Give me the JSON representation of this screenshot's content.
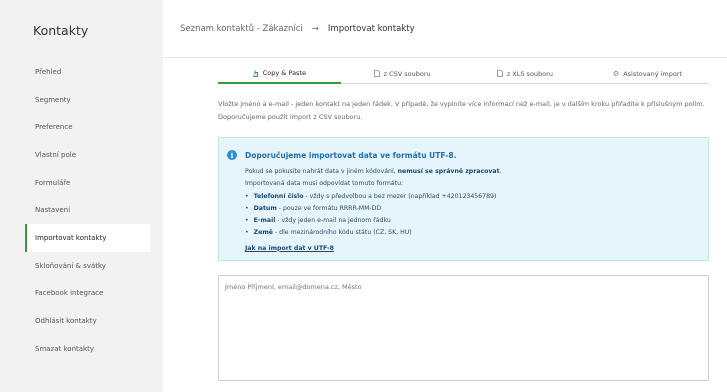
{
  "sidebar": {
    "title": "Kontakty",
    "items": [
      {
        "label": "Přehled"
      },
      {
        "label": "Segmenty"
      },
      {
        "label": "Preference"
      },
      {
        "label": "Vlastní pole"
      },
      {
        "label": "Formuláře"
      },
      {
        "label": "Nastavení"
      },
      {
        "label": "Importovat kontakty"
      },
      {
        "label": "Skloňování & svátky"
      },
      {
        "label": "Facebook integrace"
      },
      {
        "label": "Odhlásit kontakty"
      },
      {
        "label": "Smazat kontakty"
      }
    ],
    "active_index": 6
  },
  "breadcrumb": {
    "parent": "Seznam kontaktů - Zákazníci",
    "separator": "→",
    "current": "Importovat kontakty"
  },
  "tabs": [
    {
      "label": "Copy & Paste",
      "icon": "hand-pointer-icon"
    },
    {
      "label": "z CSV souboru",
      "icon": "file-icon"
    },
    {
      "label": "z XLS souboru",
      "icon": "file-icon"
    },
    {
      "label": "Asistovaný import",
      "icon": "gear-icon"
    }
  ],
  "intro": {
    "line1": "Vložte jméno a e-mail - jeden kontakt na jeden řádek. V případě, že vyplníte více informací než e-mail, je v dalším kroku přiřadíte k příslušným polím.",
    "line2": "Doporučujeme použít import z CSV souboru."
  },
  "info": {
    "title": "Doporučujeme importovat data ve formátu UTF-8.",
    "line1_pre": "Pokud se pokusíte nahrát data v jiném kódování, ",
    "line1_bold": "nemusí se správně zpracovat",
    "line1_post": ".",
    "line2": "Importovaná data musí odpovídat tomuto formátu:",
    "bullets": [
      {
        "bold": "Telefonní číslo",
        "text": " - vždy s předvolbou a bez mezer (například +420123456789)"
      },
      {
        "bold": "Datum",
        "text": " - pouze ve formátu RRRR-MM-DD"
      },
      {
        "bold": "E-mail",
        "text": " - vždy jeden e-mail na jednom řádku"
      },
      {
        "bold": "Země",
        "text": " - dle mezinárodního kódu státu (CZ, SK, HU)"
      }
    ],
    "link": "Jak na import dat v UTF-8"
  },
  "textarea": {
    "placeholder": "Jméno Příjmení, email@domena.cz, Město"
  },
  "colors": {
    "accent": "#2e9e3b",
    "info_bg": "#e6f4fb",
    "info_title": "#1f6fb0",
    "sidebar_bg": "#f2f2f2"
  }
}
